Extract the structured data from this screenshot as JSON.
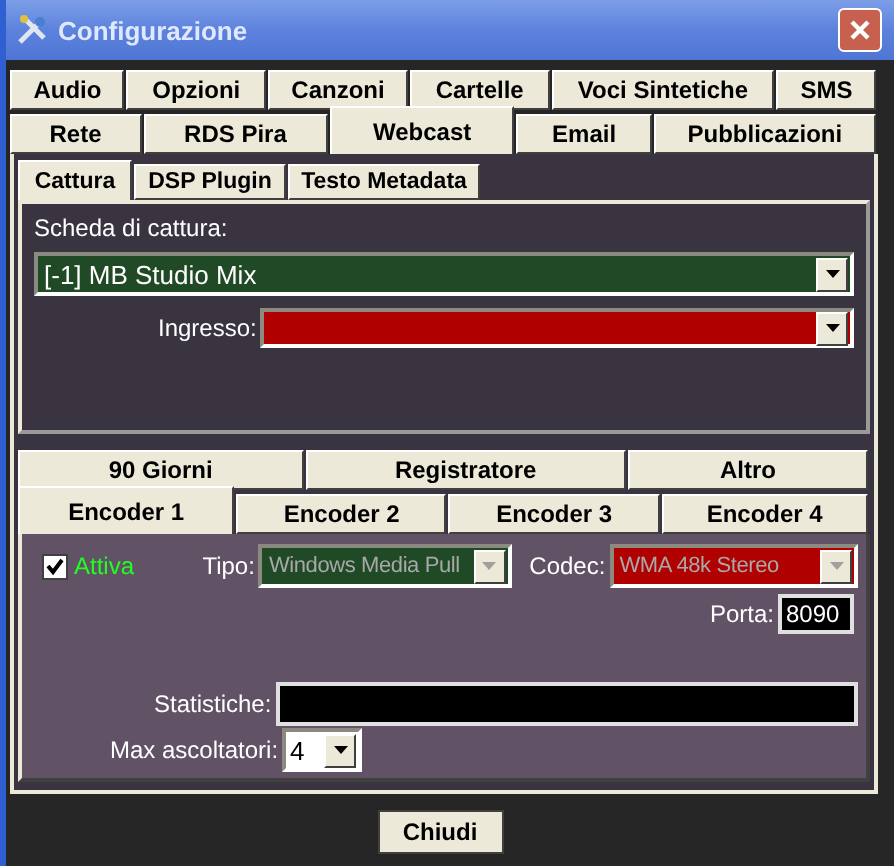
{
  "window": {
    "title": "Configurazione"
  },
  "main_tabs": [
    [
      {
        "label": "Audio",
        "selected": false
      },
      {
        "label": "Opzioni",
        "selected": false
      },
      {
        "label": "Canzoni",
        "selected": false
      },
      {
        "label": "Cartelle",
        "selected": false
      },
      {
        "label": "Voci Sintetiche",
        "selected": false
      },
      {
        "label": "SMS",
        "selected": false
      }
    ],
    [
      {
        "label": "Rete",
        "selected": false
      },
      {
        "label": "RDS Pira",
        "selected": false
      },
      {
        "label": "Webcast",
        "selected": true
      },
      {
        "label": "Email",
        "selected": false
      },
      {
        "label": "Pubblicazioni",
        "selected": false
      }
    ]
  ],
  "sub_tabs": [
    {
      "label": "Cattura",
      "selected": true
    },
    {
      "label": "DSP Plugin",
      "selected": false
    },
    {
      "label": "Testo Metadata",
      "selected": false
    }
  ],
  "capture": {
    "card_label": "Scheda di cattura:",
    "card_value": "[-1] MB Studio Mix",
    "input_label": "Ingresso:"
  },
  "encoder_tabs": [
    [
      {
        "label": "90 Giorni",
        "selected": false
      },
      {
        "label": "Registratore",
        "selected": false
      },
      {
        "label": "Altro",
        "selected": false
      }
    ],
    [
      {
        "label": "Encoder 1",
        "selected": true
      },
      {
        "label": "Encoder 2",
        "selected": false
      },
      {
        "label": "Encoder 3",
        "selected": false
      },
      {
        "label": "Encoder 4",
        "selected": false
      }
    ]
  ],
  "encoder": {
    "active": {
      "label": "Attiva",
      "checked": true
    },
    "type": {
      "label": "Tipo:",
      "value": "Windows Media Pull",
      "disabled": true
    },
    "codec": {
      "label": "Codec:",
      "value": "WMA 48k Stereo",
      "disabled": true
    },
    "port": {
      "label": "Porta:",
      "value": "8090"
    },
    "stats": {
      "label": "Statistiche:"
    },
    "max_listeners": {
      "label": "Max ascoltatori:",
      "value": "4"
    }
  },
  "footer": {
    "close_button": "Chiudi"
  }
}
